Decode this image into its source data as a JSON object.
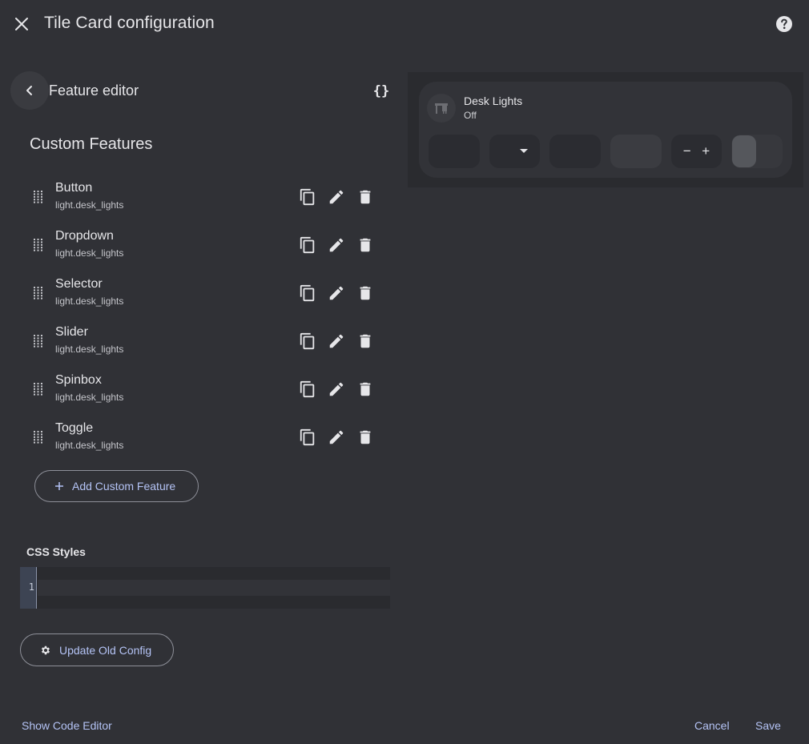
{
  "dialog": {
    "title": "Tile Card configuration"
  },
  "editor": {
    "title": "Feature editor",
    "code_toggle": "{}"
  },
  "section": {
    "title": "Custom Features"
  },
  "features": [
    {
      "name": "Button",
      "entity": "light.desk_lights"
    },
    {
      "name": "Dropdown",
      "entity": "light.desk_lights"
    },
    {
      "name": "Selector",
      "entity": "light.desk_lights"
    },
    {
      "name": "Slider",
      "entity": "light.desk_lights"
    },
    {
      "name": "Spinbox",
      "entity": "light.desk_lights"
    },
    {
      "name": "Toggle",
      "entity": "light.desk_lights"
    }
  ],
  "add_button": {
    "label": "Add Custom Feature"
  },
  "css": {
    "label": "CSS Styles",
    "line_number": "1"
  },
  "update_button": {
    "label": "Update Old Config"
  },
  "footer": {
    "show_code": "Show Code Editor",
    "cancel": "Cancel",
    "save": "Save"
  },
  "preview": {
    "entity_name": "Desk Lights",
    "state": "Off",
    "spinbox": {
      "minus": "−",
      "plus": "+"
    }
  },
  "icons": {
    "close": "close-icon",
    "help": "help-icon",
    "back": "chevron-left-icon",
    "drag": "drag-handle-icon",
    "copy": "copy-icon",
    "edit": "pencil-icon",
    "delete": "trash-icon",
    "add": "plus-icon",
    "gear": "gear-icon",
    "desk": "desk-icon",
    "dropdown": "caret-down-icon"
  },
  "colors": {
    "background": "#303136",
    "accent": "#b4c3f5",
    "text": "#e6e6e9"
  }
}
